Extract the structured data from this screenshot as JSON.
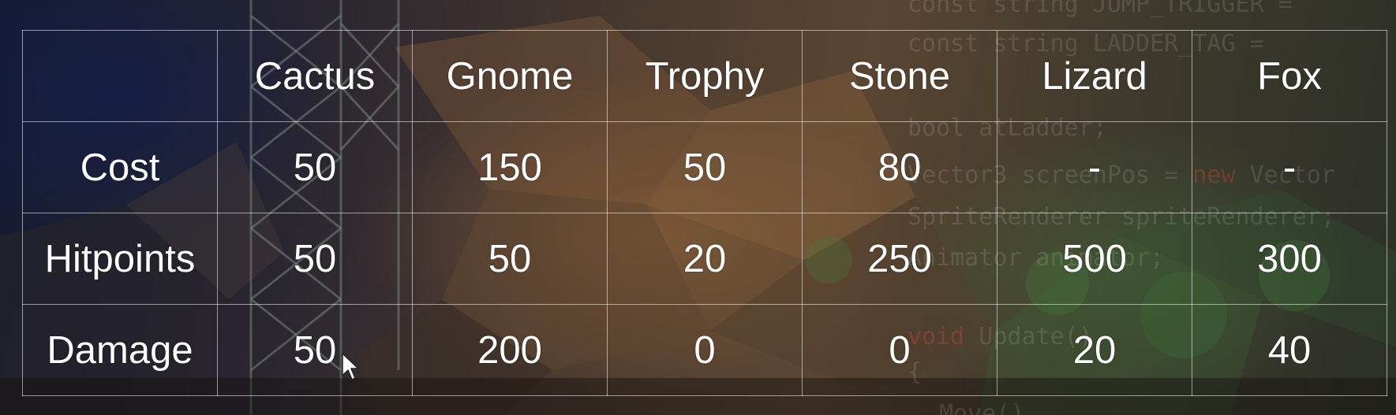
{
  "table": {
    "corner": "",
    "columns": [
      "Cactus",
      "Gnome",
      "Trophy",
      "Stone",
      "Lizard",
      "Fox"
    ],
    "rows": [
      {
        "label": "Cost",
        "values": [
          "50",
          "150",
          "50",
          "80",
          "-",
          "-"
        ]
      },
      {
        "label": "Hitpoints",
        "values": [
          "50",
          "50",
          "20",
          "250",
          "500",
          "300"
        ]
      },
      {
        "label": "Damage",
        "values": [
          "50",
          "200",
          "0",
          "0",
          "20",
          "40"
        ]
      }
    ]
  },
  "background_code": [
    {
      "pre": "const string JUMP_TRIGGER =",
      "kw": "",
      "post": ""
    },
    {
      "pre": "const string LADDER_TAG =",
      "kw": "",
      "post": ""
    },
    {
      "pre": "bool atLadder;",
      "kw": "",
      "post": ""
    },
    {
      "pre": "Vector3 screenPos = ",
      "kw": "new",
      "post": " Vector"
    },
    {
      "pre": "SpriteRenderer spriteRenderer;",
      "kw": "",
      "post": ""
    },
    {
      "pre": "Animator animator;",
      "kw": "",
      "post": ""
    },
    {
      "pre": "",
      "kw": "void",
      "post": " Update()"
    },
    {
      "pre": "{",
      "kw": "",
      "post": ""
    },
    {
      "pre": "Move()",
      "kw": "",
      "post": ""
    }
  ],
  "colors": {
    "text": "#ffffff",
    "grid_line": "#ffffff",
    "background_dark": "#141a33",
    "background_warm": "#5a4532"
  }
}
